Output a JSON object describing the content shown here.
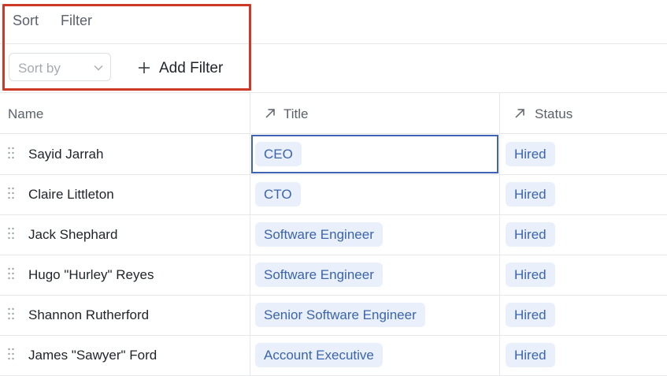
{
  "toolbar": {
    "tabs": [
      "Sort",
      "Filter"
    ],
    "sort_placeholder": "Sort by",
    "add_filter_label": "Add Filter",
    "highlight_color": "#cc3a26"
  },
  "table": {
    "columns": [
      "Name",
      "Title",
      "Status"
    ],
    "rows": [
      {
        "name": "Sayid Jarrah",
        "title": "CEO",
        "status": "Hired"
      },
      {
        "name": "Claire Littleton",
        "title": "CTO",
        "status": "Hired"
      },
      {
        "name": "Jack Shephard",
        "title": "Software Engineer",
        "status": "Hired"
      },
      {
        "name": "Hugo \"Hurley\" Reyes",
        "title": "Software Engineer",
        "status": "Hired"
      },
      {
        "name": "Shannon Rutherford",
        "title": "Senior Software Engineer",
        "status": "Hired"
      },
      {
        "name": "James \"Sawyer\" Ford",
        "title": "Account Executive",
        "status": "Hired"
      }
    ],
    "selected_cell": "Sayid Jarrah / Title",
    "pill_bg": "#eaf0fb",
    "pill_text": "#3a64ad",
    "selection_color": "#3f63b5"
  },
  "icons": {
    "sort_chevron": "chevron-down-icon",
    "add": "plus-icon",
    "column_sort": "arrow-up-right-icon",
    "row_handle": "drag-handle-icon"
  }
}
